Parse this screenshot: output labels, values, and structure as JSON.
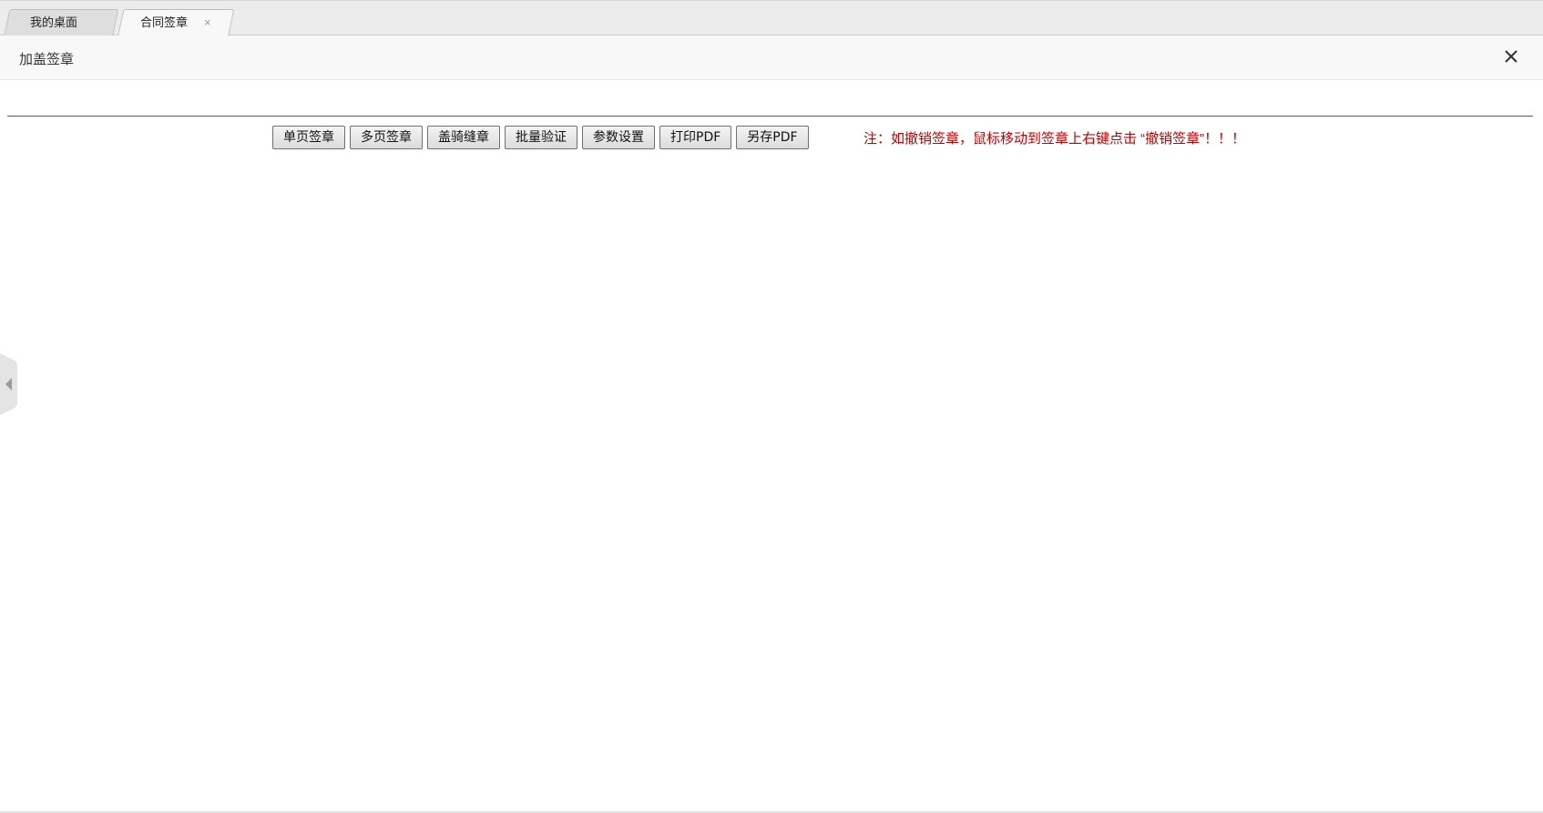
{
  "tabs": [
    {
      "label": "我的桌面",
      "active": false
    },
    {
      "label": "合同签章",
      "active": true,
      "close_glyph": "×"
    }
  ],
  "dialog": {
    "title": "加盖签章",
    "close_icon": "close-icon"
  },
  "toolbar": {
    "buttons": [
      {
        "label": "单页签章"
      },
      {
        "label": "多页签章"
      },
      {
        "label": "盖骑缝章"
      },
      {
        "label": "批量验证"
      },
      {
        "label": "参数设置"
      },
      {
        "label": "打印PDF"
      },
      {
        "label": "另存PDF"
      }
    ],
    "note": "注：如撤销签章，鼠标移动到签章上右键点击 “撤销签章”！！！"
  },
  "side_toggle": {
    "icon": "chevron-left-icon"
  },
  "colors": {
    "note_text": "#c00000",
    "tabbar_bg": "#ececec",
    "header_bg": "#f8f8f8"
  }
}
